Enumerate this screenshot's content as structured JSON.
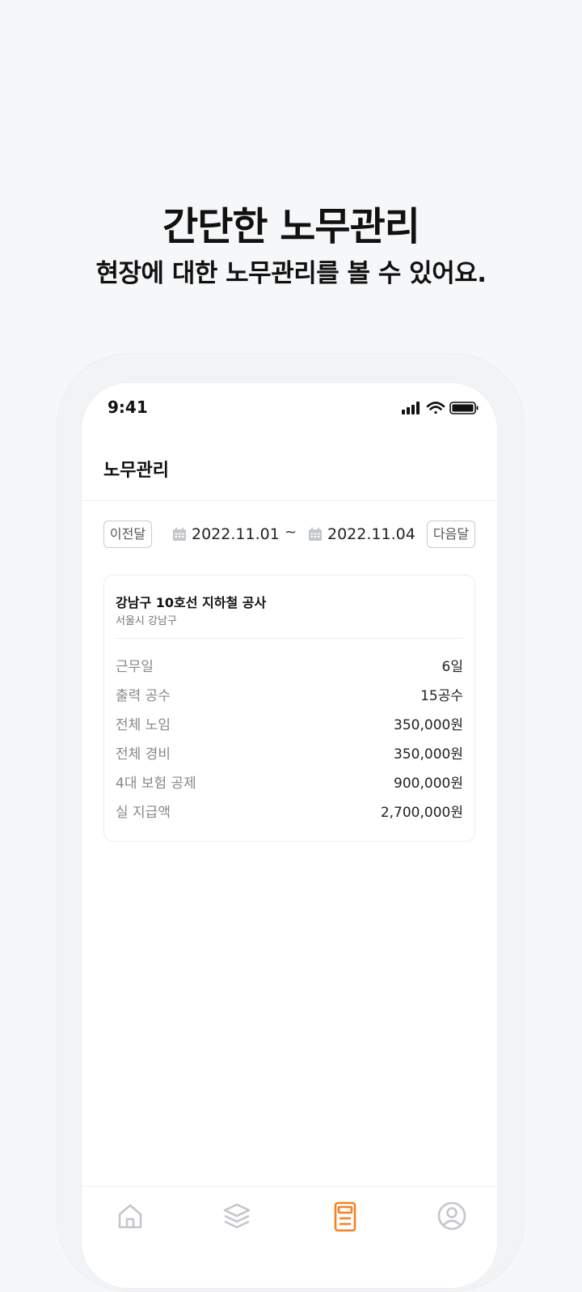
{
  "promo": {
    "title": "간단한 노무관리",
    "subtitle": "현장에 대한 노무관리를 볼 수 있어요."
  },
  "status_bar": {
    "time": "9:41",
    "icons": [
      "signal-icon",
      "wifi-icon",
      "battery-icon"
    ]
  },
  "header": {
    "title": "노무관리"
  },
  "date_filter": {
    "prev_label": "이전달",
    "next_label": "다음달",
    "start_date": "2022.11.01",
    "separator": "~",
    "end_date": "2022.11.04",
    "icon": "calendar-icon"
  },
  "site": {
    "name": "강남구 10호선 지하철 공사",
    "location": "서울시 강남구",
    "stats": [
      {
        "label": "근무일",
        "value": "6일"
      },
      {
        "label": "출력 공수",
        "value": "15공수"
      },
      {
        "label": "전체 노임",
        "value": "350,000원"
      },
      {
        "label": "전체 경비",
        "value": "350,000원"
      },
      {
        "label": "4대 보험 공제",
        "value": "900,000원"
      },
      {
        "label": "실 지급액",
        "value": "2,700,000원"
      }
    ]
  },
  "tab_bar": {
    "tabs": [
      {
        "icon": "home-icon",
        "active": false
      },
      {
        "icon": "layers-icon",
        "active": false
      },
      {
        "icon": "calculator-icon",
        "active": true
      },
      {
        "icon": "profile-icon",
        "active": false
      }
    ],
    "active_color": "#f58220",
    "inactive_color": "#c3c6cb"
  }
}
